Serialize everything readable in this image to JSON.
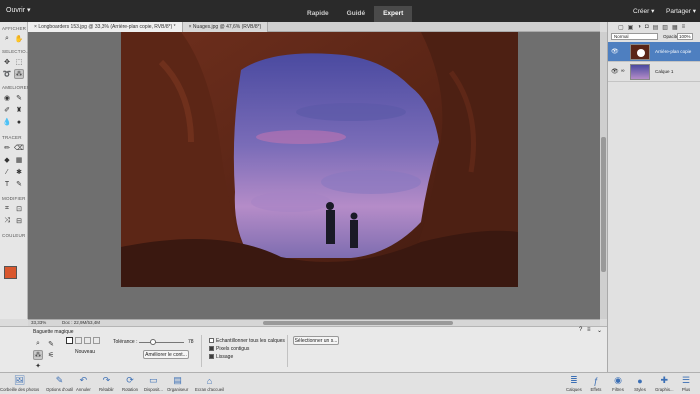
{
  "topbar": {
    "open_label": "Ouvrir",
    "modes": [
      {
        "label": "Rapide"
      },
      {
        "label": "Guidé"
      },
      {
        "label": "Expert"
      }
    ],
    "create_label": "Créer",
    "share_label": "Partager"
  },
  "doc_tabs": [
    {
      "label": "Longboarders 153.jpg @ 33,3% (Arrière-plan copie, RVB/8*) *"
    },
    {
      "label": "Nuages.jpg @ 47,6% (RVB/8*)"
    }
  ],
  "toolbox": {
    "sections": {
      "view": "AFFICHER",
      "select": "SELECTIO...",
      "enhance": "AMELIORER",
      "draw": "TRACER",
      "modify": "MODIFIER",
      "color": "COULEUR"
    },
    "foreground_color": "#d9572e",
    "background_color": "#000000"
  },
  "status": {
    "zoom": "33,33%",
    "doc": "Doc : 22,9M/53,4M"
  },
  "options": {
    "tool_name": "Baguette magique",
    "mode_label": "Nouveau",
    "tolerance_label": "Tolérance :",
    "tolerance_value": "78",
    "tolerance_fraction": 0.31,
    "refine_button": "Améliorer le cont...",
    "sample_all_layers": "Echantillonner tous les calques",
    "contiguous": "Pixels contigus",
    "antialias": "Lissage",
    "select_subject": "Sélectionner un s..."
  },
  "bottombar": {
    "left": [
      {
        "label": "Corbeille des photos",
        "icon": "photo-bin-icon"
      },
      {
        "label": "Options d'outil",
        "icon": "tool-options-icon"
      },
      {
        "label": "Annuler",
        "icon": "undo-icon"
      },
      {
        "label": "Rétablir",
        "icon": "redo-icon"
      },
      {
        "label": "Rotation",
        "icon": "rotate-icon"
      },
      {
        "label": "Disposit...",
        "icon": "layout-icon"
      },
      {
        "label": "Organiseur",
        "icon": "organizer-icon"
      },
      {
        "label": "Ecran d'accueil",
        "icon": "home-icon"
      }
    ],
    "right": [
      {
        "label": "Calques",
        "icon": "layers-icon"
      },
      {
        "label": "Effets",
        "icon": "effects-icon"
      },
      {
        "label": "Filtres",
        "icon": "filters-icon"
      },
      {
        "label": "Styles",
        "icon": "styles-icon"
      },
      {
        "label": "Graphis...",
        "icon": "graphics-icon"
      },
      {
        "label": "Plus",
        "icon": "more-icon"
      }
    ]
  },
  "layers_panel": {
    "blend_mode": "Normal",
    "opacity_label": "Opacité :",
    "opacity_value": "100%",
    "layers": [
      {
        "name": "Arrière-plan copie"
      },
      {
        "name": "Calque 1"
      }
    ]
  }
}
